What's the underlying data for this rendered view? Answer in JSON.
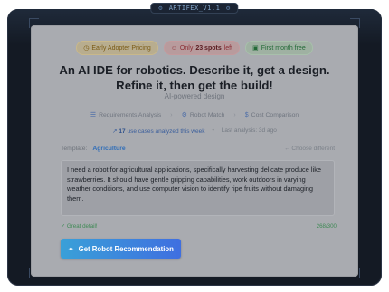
{
  "top_badge": {
    "label": "ARTIFEX_V1.1"
  },
  "pills": [
    {
      "icon": "clock-icon",
      "label": "Early Adopter Pricing"
    },
    {
      "icon": "users-icon",
      "prefix": "Only",
      "bold": "23 spots",
      "suffix": "left"
    },
    {
      "icon": "gift-icon",
      "label": "First month free"
    }
  ],
  "headline": "An AI IDE for robotics. Describe it, get a design. Refine it, then get the build!",
  "subheadline": "AI-powered design",
  "steps": [
    {
      "icon": "list-icon",
      "label": "Requirements Analysis"
    },
    {
      "icon": "robot-icon",
      "label": "Robot Match"
    },
    {
      "icon": "dollar-icon",
      "label": "Cost Comparison"
    }
  ],
  "stats": {
    "count": "17",
    "count_text": "use cases analyzed this week",
    "last": "Last analysis: 3d ago"
  },
  "template": {
    "label": "Template:",
    "value": "Agriculture",
    "choose": "← Choose different"
  },
  "input_text": "I need a robot for agricultural applications, specifically harvesting delicate produce like strawberries. It should have gentle gripping capabilities, work outdoors in varying weather conditions, and use computer vision to identify ripe fruits without damaging them.",
  "input_status": "✓ Great detail!",
  "char_count": "268/300",
  "cta": {
    "label": "Get Robot Recommendation",
    "icon": "sparkle-icon"
  },
  "colors": {
    "accent": "#3f6fe0",
    "frame": "#141a24"
  }
}
